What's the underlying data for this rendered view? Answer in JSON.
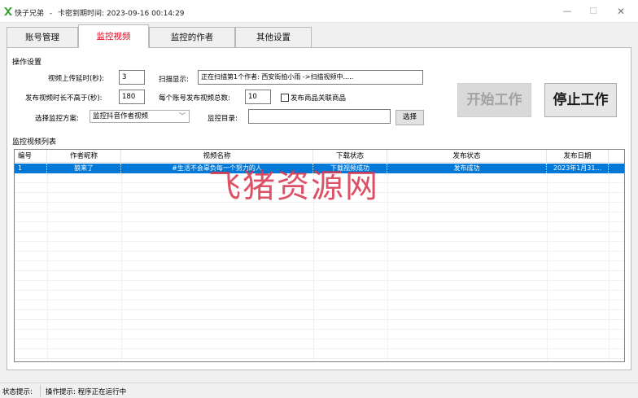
{
  "window": {
    "app_name": "快子兄弟",
    "separator": "-",
    "expiry_label": "卡密到期时间:",
    "expiry_value": "2023-09-16 00:14:29",
    "brand_color": "#2e9f2e"
  },
  "tabs": [
    {
      "label": "账号管理",
      "active": false
    },
    {
      "label": "监控视频",
      "active": true
    },
    {
      "label": "监控的作者",
      "active": false
    },
    {
      "label": "其他设置",
      "active": false
    }
  ],
  "settings": {
    "group_title": "操作设置",
    "upload_delay_label": "视频上传延时(秒):",
    "upload_delay_value": "3",
    "scan_label": "扫描显示:",
    "scan_value": "正在扫描第1个作者: 西安街拍小雨 ->扫描视频中.....",
    "max_duration_label": "发布视频时长不高于(秒):",
    "max_duration_value": "180",
    "per_account_label": "每个账号发布视频总数:",
    "per_account_value": "10",
    "product_checkbox_label": "发布商品关联商品",
    "product_checkbox_checked": false,
    "scheme_label": "选择监控方案:",
    "scheme_value": "监控抖音作者视频",
    "dir_label": "监控目录:",
    "dir_value": "",
    "choose_button": "选择",
    "start_button": "开始工作",
    "stop_button": "停止工作"
  },
  "list": {
    "group_title": "监控视频列表",
    "columns": [
      "编号",
      "作者昵称",
      "视频名称",
      "下载状态",
      "发布状态",
      "发布日期"
    ],
    "rows": [
      {
        "id": "1",
        "author": "狼来了",
        "title": "#生活不会辜负每一个努力的人",
        "download_status": "下载视频成功",
        "publish_status": "发布成功",
        "date": "2023年1月31..."
      }
    ]
  },
  "watermark": "飞猪资源网",
  "status": {
    "label": "状态提示:",
    "text": "操作提示: 程序正在运行中"
  },
  "colors": {
    "active_tab_text": "#e0001b",
    "selection": "#0078d7",
    "watermark": "#d93a52"
  }
}
